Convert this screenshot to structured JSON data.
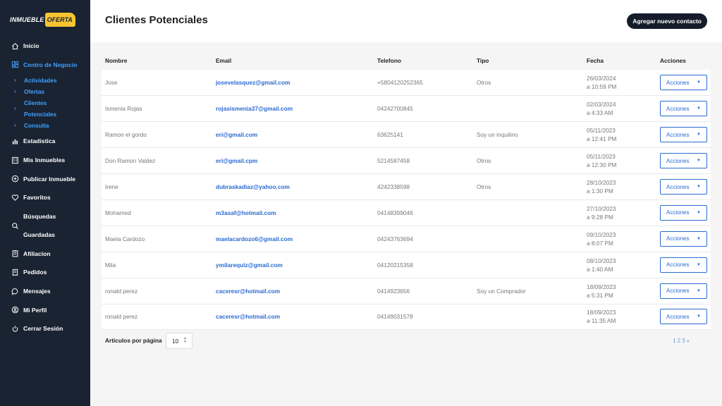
{
  "brand": {
    "logo_left": "INMUEBLE",
    "logo_right": "OFERTA"
  },
  "sidebar": {
    "items": [
      {
        "key": "inicio",
        "label": "Inicio",
        "icon": "home-icon"
      },
      {
        "key": "centro",
        "label": "Centro de Negocio",
        "icon": "dashboard-icon",
        "active": true
      },
      {
        "key": "estadistica",
        "label": "Estadistica",
        "icon": "chart-icon"
      },
      {
        "key": "inmuebles",
        "label": "Mis Inmuebles",
        "icon": "building-icon"
      },
      {
        "key": "publicar",
        "label": "Publicar Inmueble",
        "icon": "plus-circle-icon"
      },
      {
        "key": "favoritos",
        "label": "Favoritos",
        "icon": "heart-icon"
      },
      {
        "key": "busquedas",
        "label_1": "Búsquedas",
        "label_2": "Guardadas",
        "icon": "search-icon"
      },
      {
        "key": "afiliacion",
        "label": "Afiliacion",
        "icon": "clipboard-icon"
      },
      {
        "key": "pedidos",
        "label": "Pedidos",
        "icon": "receipt-icon"
      },
      {
        "key": "mensajes",
        "label": "Mensajes",
        "icon": "chat-icon"
      },
      {
        "key": "perfil",
        "label": "Mi Perfil",
        "icon": "user-circle-icon"
      },
      {
        "key": "cerrar",
        "label": "Cerrar Sesión",
        "icon": "power-icon"
      }
    ],
    "sub_items": [
      {
        "label": "Actividades"
      },
      {
        "label": "Ofertas"
      },
      {
        "label_1": "Clientes",
        "label_2": "Potenciales"
      },
      {
        "label": "Consulta"
      }
    ]
  },
  "header": {
    "title": "Clientes Potenciales",
    "add_button": "Agregar nuevo contacto"
  },
  "table": {
    "columns": [
      "Nombre",
      "Email",
      "Telefono",
      "Tipo",
      "Fecha",
      "Acciones"
    ],
    "action_label": "Acciones",
    "rows": [
      {
        "nombre": "Jose",
        "email": "josevelasquez@gmail.com",
        "telefono": "+5804120252365",
        "tipo": "Otros",
        "fecha": "26/03/2024",
        "hora": "a 10:59 PM"
      },
      {
        "nombre": "Ismenia Rojas",
        "email": "rojasismenia37@gmail.com",
        "telefono": "04242700845",
        "tipo": "",
        "fecha": "02/03/2024",
        "hora": "a 4:33 AM"
      },
      {
        "nombre": "Ramon el gordo",
        "email": "eri@gmail.com",
        "telefono": "63625141",
        "tipo": "Soy un inquilino",
        "fecha": "05/11/2023",
        "hora": "a 12:41 PM"
      },
      {
        "nombre": "Don Ramon Valdez",
        "email": "eri@gmail.cpm",
        "telefono": "5214587458",
        "tipo": "Otros",
        "fecha": "05/11/2023",
        "hora": "a 12:30 PM"
      },
      {
        "nombre": "Irene",
        "email": "dubraskadiaz@yahoo.com",
        "telefono": "4242338598",
        "tipo": "Otros",
        "fecha": "28/10/2023",
        "hora": "a 1:30 PM"
      },
      {
        "nombre": "Mohamed",
        "email": "m3asaf@hotmail.com",
        "telefono": "04148399046",
        "tipo": "",
        "fecha": "27/10/2023",
        "hora": "a 9:28 PM"
      },
      {
        "nombre": "Maela Cardozo",
        "email": "maelacardozo6@gmail.com",
        "telefono": "04243763694",
        "tipo": "",
        "fecha": "09/10/2023",
        "hora": "a 8:07 PM"
      },
      {
        "nombre": "Mila",
        "email": "ymilarequiz@gmail.com",
        "telefono": "04120215358",
        "tipo": "",
        "fecha": "08/10/2023",
        "hora": "a 1:40 AM"
      },
      {
        "nombre": "ronald perez",
        "email": "caceresr@hotmail.com",
        "telefono": "0414923656",
        "tipo": "Soy un Comprador",
        "fecha": "18/09/2023",
        "hora": "a 5:31 PM"
      },
      {
        "nombre": "ronald perez",
        "email": "caceresr@hotmail.com",
        "telefono": "04149031578",
        "tipo": "",
        "fecha": "18/09/2023",
        "hora": "a 11:35 AM"
      }
    ]
  },
  "footer": {
    "per_page_label": "Articulos por página",
    "per_page_value": "10",
    "pages": [
      "1",
      "2",
      "3",
      "»"
    ]
  },
  "colors": {
    "sidebar_bg": "#1a2332",
    "accent": "#2a6bd1",
    "active_nav": "#3fa0ff",
    "logo_yellow": "#f6c431"
  }
}
